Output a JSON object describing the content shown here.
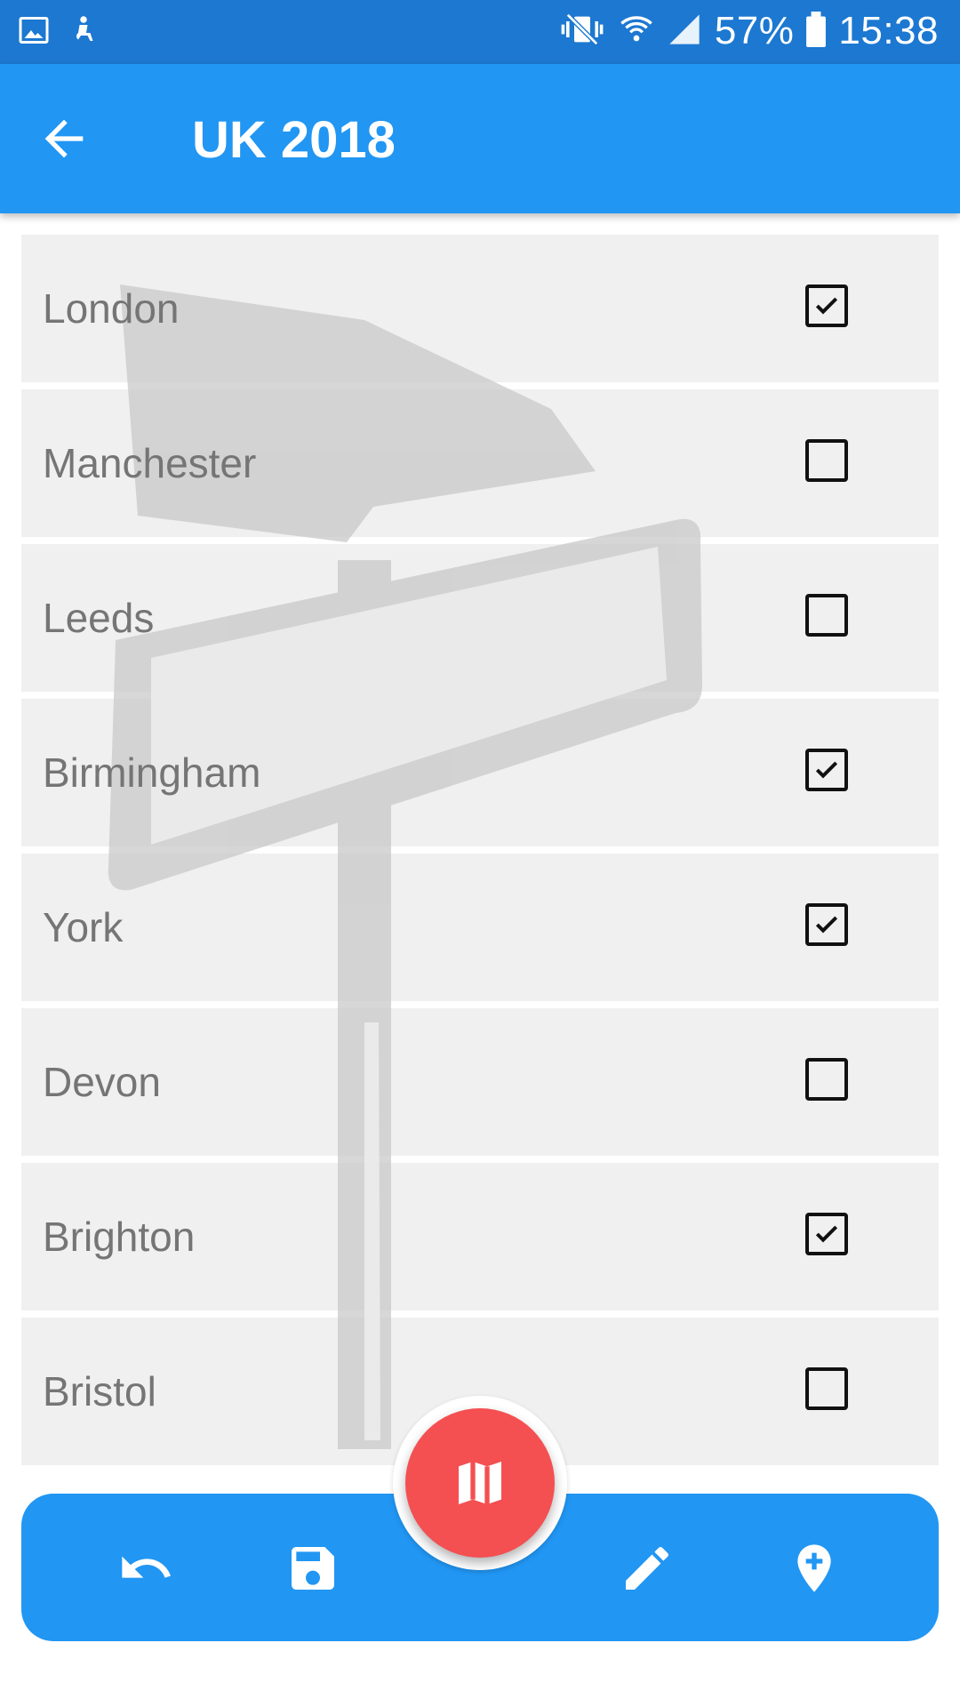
{
  "status_bar": {
    "battery": "57%",
    "time": "15:38",
    "icons": [
      "gallery-icon",
      "accessibility-icon",
      "vibrate-icon",
      "wifi-icon",
      "signal-icon",
      "battery-icon"
    ]
  },
  "app_bar": {
    "title": "UK 2018",
    "back_icon": "arrow-back-icon"
  },
  "colors": {
    "status_bar": "#1c78d1",
    "primary": "#2196f3",
    "fab": "#f44f51",
    "row_bg": "#f0f0f0",
    "row_text": "#757575"
  },
  "cities": [
    {
      "label": "London",
      "checked": true
    },
    {
      "label": "Manchester",
      "checked": false
    },
    {
      "label": "Leeds",
      "checked": false
    },
    {
      "label": "Birmingham",
      "checked": true
    },
    {
      "label": "York",
      "checked": true
    },
    {
      "label": "Devon",
      "checked": false
    },
    {
      "label": "Brighton",
      "checked": true
    },
    {
      "label": "Bristol",
      "checked": false
    }
  ],
  "bottom_bar": {
    "icons": [
      "undo-icon",
      "save-icon",
      "map-icon",
      "edit-icon",
      "add-location-icon"
    ]
  }
}
